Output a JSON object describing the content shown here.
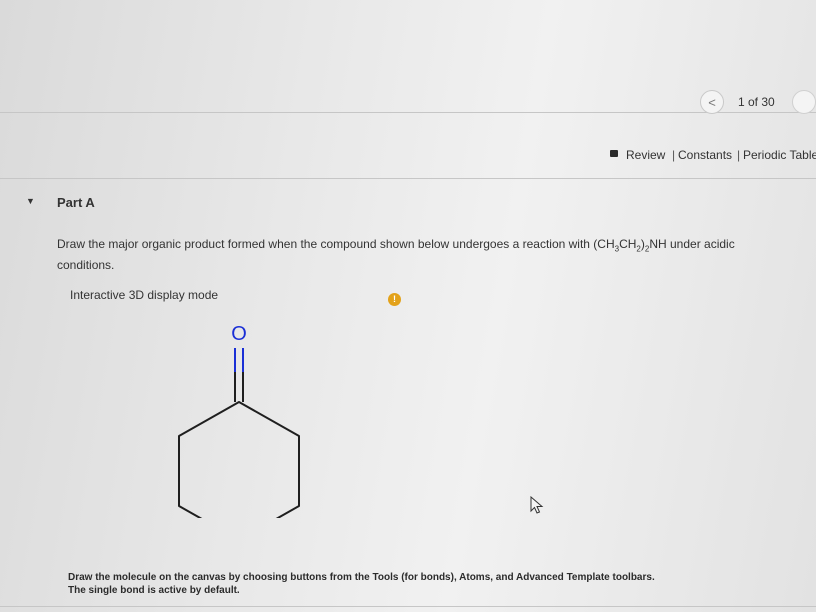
{
  "nav": {
    "prev_icon": "chevron-left-icon",
    "prev_glyph": "<",
    "counter": "1 of 30"
  },
  "resources": {
    "review": "Review",
    "sep": "|",
    "constants": "Constants",
    "periodic_table": "Periodic Table"
  },
  "part": {
    "title": "Part A",
    "question_start": "Draw the major organic product formed when the compound shown below undergoes a reaction with (CH",
    "sub1": "3",
    "mid1": "CH",
    "sub2": "2",
    "mid2": ")",
    "sub3": "2",
    "question_end": "NH under acidic conditions.",
    "mode_label": "Interactive 3D display mode",
    "info_glyph": "!"
  },
  "molecule": {
    "name": "cyclohexanone",
    "oxygen_label": "O",
    "bond_color": "#1f1f1f",
    "oxygen_color": "#1a2fd6"
  },
  "instructions": {
    "line1": "Draw the molecule on the canvas by choosing buttons from the Tools (for bonds), Atoms, and Advanced Template toolbars.",
    "line2": "The single bond is active by default."
  }
}
